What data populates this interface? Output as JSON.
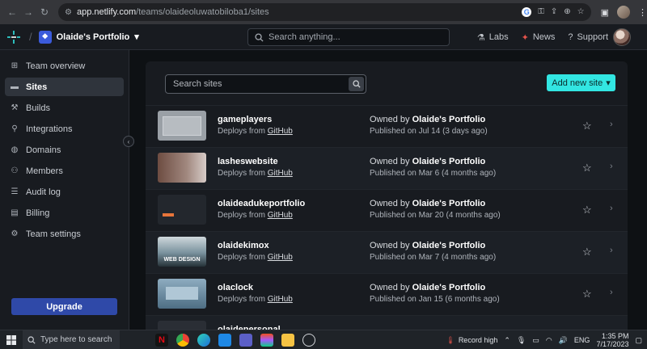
{
  "browser": {
    "url_host": "app.netlify.com",
    "url_path": "/teams/olaideoluwatobiloba1/sites"
  },
  "header": {
    "team_name": "Olaide's Portfolio",
    "search_placeholder": "Search anything...",
    "nav": [
      {
        "label": "Labs",
        "icon": "flask-icon"
      },
      {
        "label": "News",
        "icon": "megaphone-icon"
      },
      {
        "label": "Support",
        "icon": "help-circle-icon"
      }
    ]
  },
  "sidebar": {
    "items": [
      {
        "label": "Team overview",
        "icon": "team-overview-icon",
        "active": false
      },
      {
        "label": "Sites",
        "icon": "sites-icon",
        "active": true
      },
      {
        "label": "Builds",
        "icon": "builds-icon",
        "active": false
      },
      {
        "label": "Integrations",
        "icon": "integrations-icon",
        "active": false
      },
      {
        "label": "Domains",
        "icon": "globe-icon",
        "active": false
      },
      {
        "label": "Members",
        "icon": "members-icon",
        "active": false
      },
      {
        "label": "Audit log",
        "icon": "audit-log-icon",
        "active": false
      },
      {
        "label": "Billing",
        "icon": "billing-icon",
        "active": false
      },
      {
        "label": "Team settings",
        "icon": "gear-icon",
        "active": false
      }
    ],
    "upgrade_label": "Upgrade"
  },
  "main": {
    "search_placeholder": "Search sites",
    "add_button_label": "Add new site",
    "deploys_prefix": "Deploys from",
    "owned_prefix": "Owned by",
    "sites": [
      {
        "name": "gameplayers",
        "source": "GitHub",
        "owner": "Olaide's Portfolio",
        "published": "Published on Jul 14 (3 days ago)",
        "thumb": "t1"
      },
      {
        "name": "lasheswebsite",
        "source": "GitHub",
        "owner": "Olaide's Portfolio",
        "published": "Published on Mar 6 (4 months ago)",
        "thumb": "t2"
      },
      {
        "name": "olaideadukeportfolio",
        "source": "GitHub",
        "owner": "Olaide's Portfolio",
        "published": "Published on Mar 20 (4 months ago)",
        "thumb": "t3"
      },
      {
        "name": "olaidekimox",
        "source": "GitHub",
        "owner": "Olaide's Portfolio",
        "published": "Published on Mar 7 (4 months ago)",
        "thumb": "t4",
        "thumb_text": "WEB DESIGN"
      },
      {
        "name": "olaclock",
        "source": "GitHub",
        "owner": "Olaide's Portfolio",
        "published": "Published on Jan 15 (6 months ago)",
        "thumb": "t5"
      },
      {
        "name": "olaidepersonal",
        "source": "",
        "owner": "",
        "published": "",
        "thumb": "t6"
      }
    ]
  },
  "taskbar": {
    "search_placeholder": "Type here to search",
    "weather_label": "Record high",
    "language": "ENG",
    "time": "1:35 PM",
    "date": "7/17/2023"
  }
}
